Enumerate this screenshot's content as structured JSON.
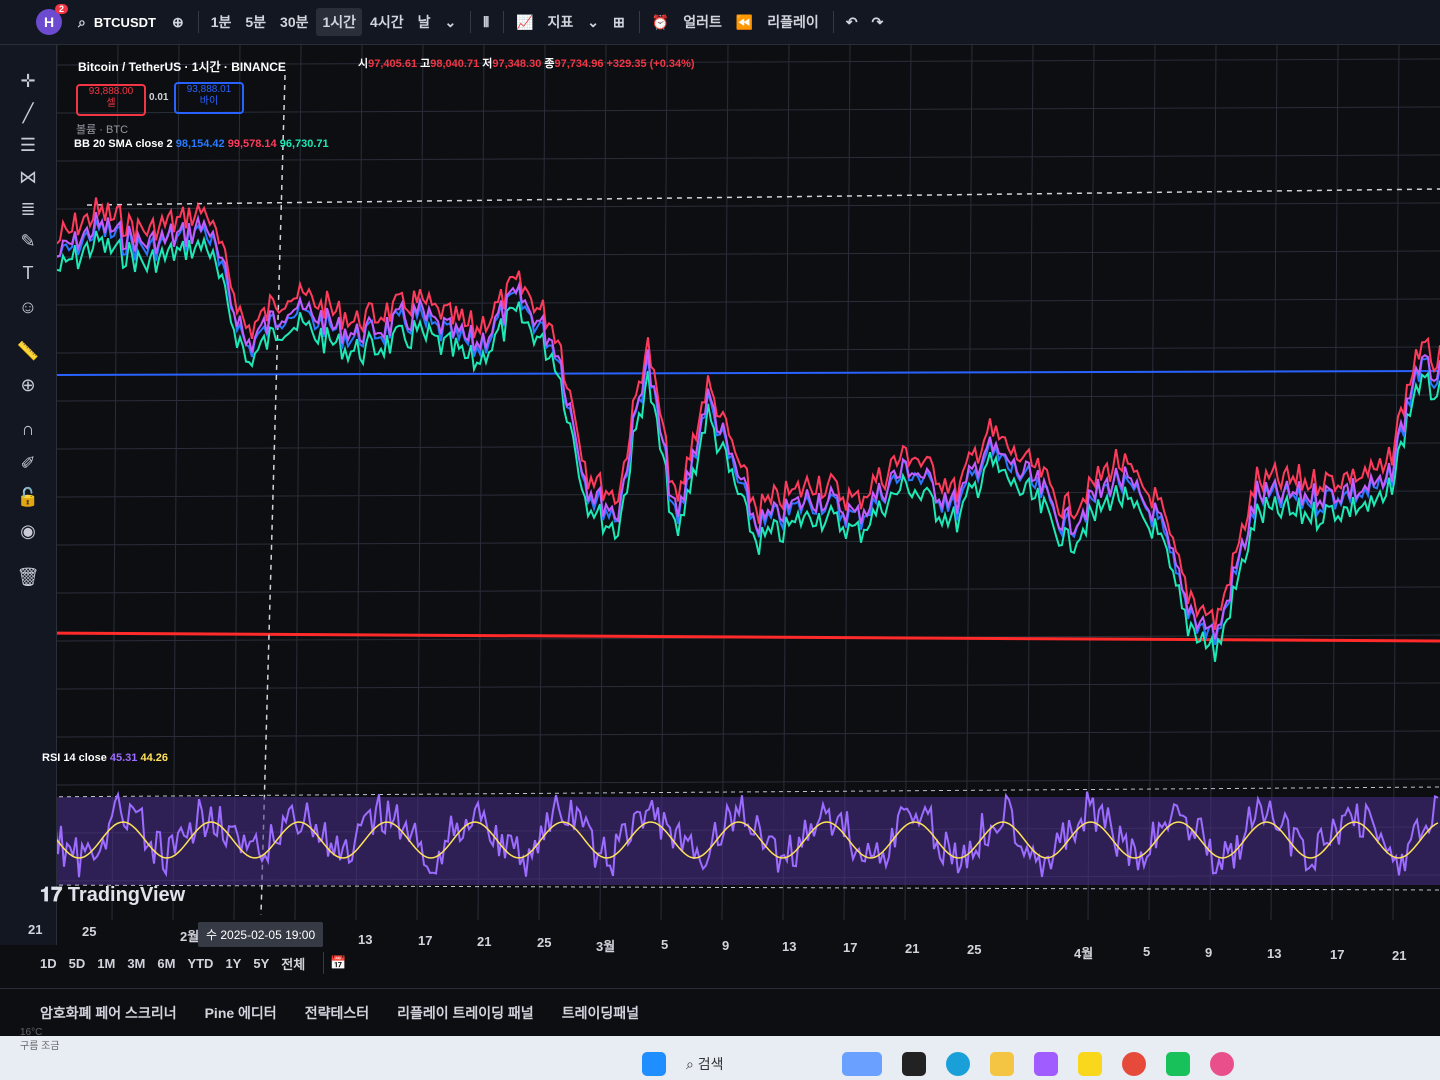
{
  "header": {
    "avatar_letter": "H",
    "avatar_badge": "2",
    "symbol": "BTCUSDT",
    "intervals": [
      "1분",
      "5분",
      "30분",
      "1시간",
      "4시간",
      "날"
    ],
    "active_interval": "1시간",
    "indicators_label": "지표",
    "alerts_label": "얼러트",
    "replay_label": "리플레이"
  },
  "legend": {
    "title": "Bitcoin / TetherUS · 1시간 · BINANCE",
    "open_label": "시",
    "open": "97,405.61",
    "high_label": "고",
    "high": "98,040.71",
    "low_label": "저",
    "low": "97,348.30",
    "close_label": "종",
    "close": "97,734.96",
    "change": "+329.35 (+0.34%)",
    "sell_price": "93,888.00",
    "sell_label": "셀",
    "spread": "0.01",
    "buy_price": "93,888.01",
    "buy_label": "바이",
    "volume_label": "볼륨 · BTC",
    "bb_label": "BB 20 SMA close 2",
    "bb_basis": "98,154.42",
    "bb_upper": "99,578.14",
    "bb_lower": "96,730.71",
    "rsi_label": "RSI 14 close",
    "rsi_value": "45.31",
    "rsi_ma": "44.26"
  },
  "brand": "TradingView",
  "time_axis": {
    "ticks": [
      "21",
      "25",
      "2월",
      "13",
      "17",
      "21",
      "25",
      "3월",
      "5",
      "9",
      "13",
      "17",
      "21",
      "25",
      "4월",
      "5",
      "9",
      "13",
      "17",
      "21"
    ],
    "crosshair_label": "수 2025-02-05   19:00"
  },
  "date_ranges": [
    "1D",
    "5D",
    "1M",
    "3M",
    "6M",
    "YTD",
    "1Y",
    "5Y",
    "전체"
  ],
  "bottom_panels": [
    "암호화폐 페어 스크리너",
    "Pine 에디터",
    "전략테스터",
    "리플레이 트레이딩 패널",
    "트레이딩패널"
  ],
  "taskbar": {
    "search_placeholder": "검색",
    "weather_temp": "16°C",
    "weather_desc": "구름 조금"
  },
  "colors": {
    "upper_band": "#ff3b5c",
    "lower_band": "#1de9b6",
    "price": "#2979ff",
    "mix": "#c45cff",
    "rsi": "#9c6bff",
    "rsi_ma": "#ffe15a",
    "support_line": "#ff2a2a",
    "ref_line": "#2962ff"
  },
  "icons": [
    "crosshair-icon",
    "trend-line-icon",
    "fib-icon",
    "pattern-icon",
    "measure-icon",
    "brush-icon",
    "text-icon",
    "emoji-icon",
    "ruler-icon",
    "zoom-icon",
    "magnet-icon",
    "lock-draw-icon",
    "lock-icon",
    "eye-icon",
    "trash-icon"
  ]
}
